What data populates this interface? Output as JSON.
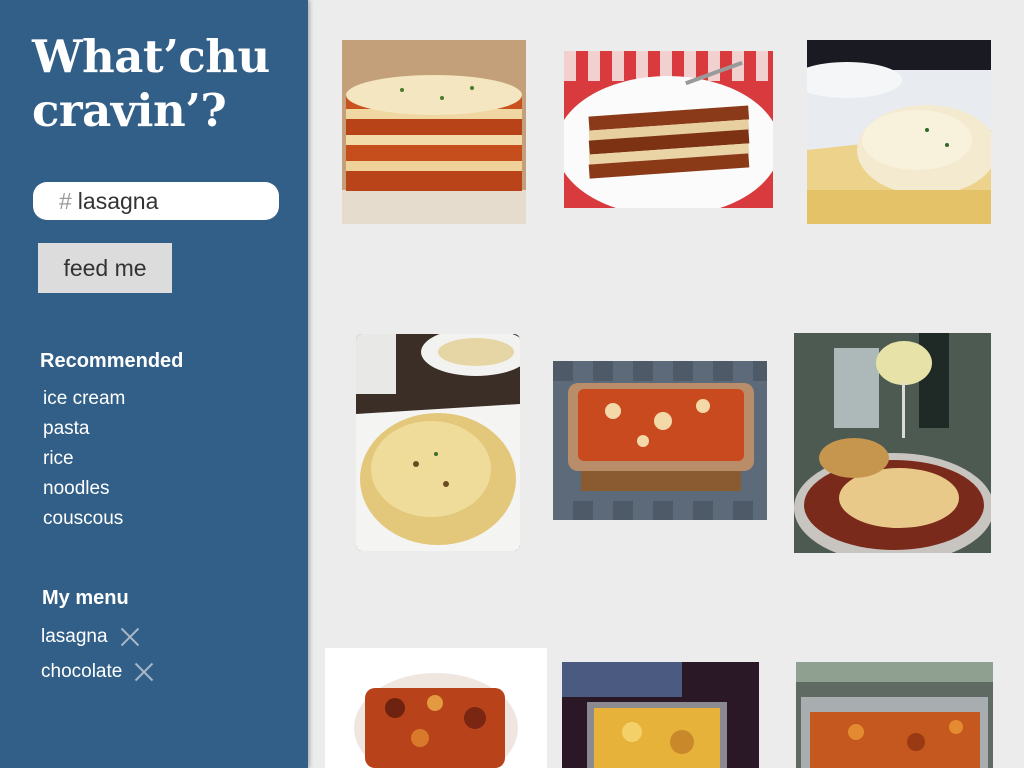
{
  "sidebar": {
    "title": "What’chu cravin’?",
    "search": {
      "prefix": "#",
      "value": "lasagna"
    },
    "submit_label": "feed me",
    "recommended": {
      "heading": "Recommended",
      "items": [
        "ice cream",
        "pasta",
        "rice",
        "noodles",
        "couscous"
      ]
    },
    "my_menu": {
      "heading": "My menu",
      "items": [
        "lasagna",
        "chocolate"
      ]
    }
  },
  "gallery": {
    "photos": [
      {
        "subject": "lasagna-slice-photo",
        "icon": "photo-icon"
      },
      {
        "subject": "lasagna-on-plate-photo",
        "icon": "photo-icon"
      },
      {
        "subject": "white-sauce-lasagna-photo",
        "icon": "photo-icon"
      },
      {
        "subject": "cheesy-baked-pasta-photo",
        "icon": "photo-icon"
      },
      {
        "subject": "lasagna-in-glass-dish-photo",
        "icon": "photo-icon"
      },
      {
        "subject": "lasagna-with-wine-photo",
        "icon": "photo-icon"
      },
      {
        "subject": "lasagna-closeup-photo",
        "icon": "photo-icon"
      },
      {
        "subject": "lasagna-in-oven-dish-photo",
        "icon": "photo-icon"
      },
      {
        "subject": "lasagna-in-tray-photo",
        "icon": "photo-icon"
      }
    ]
  },
  "colors": {
    "sidebar": "#325f87",
    "background": "#ececec",
    "button": "#dcdcdc"
  }
}
